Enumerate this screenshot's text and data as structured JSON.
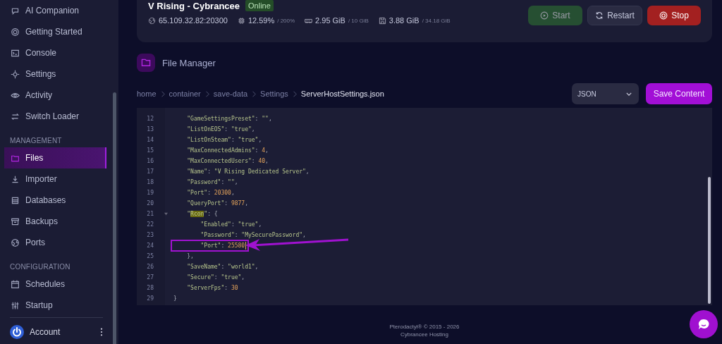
{
  "sidebar": {
    "sections": [
      {
        "items": [
          {
            "label": "AI Companion",
            "selected": false
          },
          {
            "label": "Getting Started",
            "selected": false
          },
          {
            "label": "Console",
            "selected": false
          },
          {
            "label": "Settings",
            "selected": false
          },
          {
            "label": "Activity",
            "selected": false
          },
          {
            "label": "Switch Loader",
            "selected": false
          }
        ]
      },
      {
        "title": "MANAGEMENT",
        "items": [
          {
            "label": "Files",
            "selected": true
          },
          {
            "label": "Importer",
            "selected": false
          },
          {
            "label": "Databases",
            "selected": false
          },
          {
            "label": "Backups",
            "selected": false
          },
          {
            "label": "Ports",
            "selected": false
          }
        ]
      },
      {
        "title": "CONFIGURATION",
        "items": [
          {
            "label": "Schedules",
            "selected": false
          },
          {
            "label": "Startup",
            "selected": false
          }
        ]
      }
    ],
    "account": "Account"
  },
  "server": {
    "name": "V Rising - Cybrancee",
    "status": "Online",
    "stats": [
      {
        "value": "65.109.32.82:20300"
      },
      {
        "value": "12.59%",
        "limit": "/ 200%"
      },
      {
        "value": "2.95 GiB",
        "limit": "/ 10 GiB"
      },
      {
        "value": "3.88 GiB",
        "limit": "/ 34.18 GiB"
      }
    ],
    "buttons": [
      {
        "label": "Start",
        "kind": "start",
        "disabled": true
      },
      {
        "label": "Restart",
        "kind": "restart",
        "disabled": false
      },
      {
        "label": "Stop",
        "kind": "stop",
        "disabled": false
      }
    ]
  },
  "file_manager": {
    "title": "File Manager",
    "breadcrumb": [
      "home",
      "container",
      "save-data",
      "Settings",
      "ServerHostSettings.json"
    ],
    "mode": "JSON",
    "save_button": "Save Content",
    "lines": [
      {
        "number": "12",
        "parts": [
          {
            "kind": "str",
            "text": "    \"GameSettingsPreset\""
          },
          {
            "kind": "punct",
            "text": ": "
          },
          {
            "kind": "str",
            "text": "\"\""
          },
          {
            "kind": "punct",
            "text": ","
          }
        ]
      },
      {
        "number": "13",
        "parts": [
          {
            "kind": "str",
            "text": "    \"ListOnEOS\""
          },
          {
            "kind": "punct",
            "text": ": "
          },
          {
            "kind": "str",
            "text": "\"true\""
          },
          {
            "kind": "punct",
            "text": ","
          }
        ]
      },
      {
        "number": "14",
        "parts": [
          {
            "kind": "str",
            "text": "    \"ListOnSteam\""
          },
          {
            "kind": "punct",
            "text": ": "
          },
          {
            "kind": "str",
            "text": "\"true\""
          },
          {
            "kind": "punct",
            "text": ","
          }
        ]
      },
      {
        "number": "15",
        "parts": [
          {
            "kind": "str",
            "text": "    \"MaxConnectedAdmins\""
          },
          {
            "kind": "punct",
            "text": ": "
          },
          {
            "kind": "num",
            "text": "4"
          },
          {
            "kind": "punct",
            "text": ","
          }
        ]
      },
      {
        "number": "16",
        "parts": [
          {
            "kind": "str",
            "text": "    \"MaxConnectedUsers\""
          },
          {
            "kind": "punct",
            "text": ": "
          },
          {
            "kind": "num",
            "text": "40"
          },
          {
            "kind": "punct",
            "text": ","
          }
        ]
      },
      {
        "number": "17",
        "parts": [
          {
            "kind": "str",
            "text": "    \"Name\""
          },
          {
            "kind": "punct",
            "text": ": "
          },
          {
            "kind": "str",
            "text": "\"V Rising Dedicated Server\""
          },
          {
            "kind": "punct",
            "text": ","
          }
        ]
      },
      {
        "number": "18",
        "parts": [
          {
            "kind": "str",
            "text": "    \"Password\""
          },
          {
            "kind": "punct",
            "text": ": "
          },
          {
            "kind": "str",
            "text": "\"\""
          },
          {
            "kind": "punct",
            "text": ","
          }
        ]
      },
      {
        "number": "19",
        "parts": [
          {
            "kind": "str",
            "text": "    \"Port\""
          },
          {
            "kind": "punct",
            "text": ": "
          },
          {
            "kind": "num",
            "text": "20300"
          },
          {
            "kind": "punct",
            "text": ","
          }
        ]
      },
      {
        "number": "20",
        "parts": [
          {
            "kind": "str",
            "text": "    \"QueryPort\""
          },
          {
            "kind": "punct",
            "text": ": "
          },
          {
            "kind": "num",
            "text": "9877"
          },
          {
            "kind": "punct",
            "text": ","
          }
        ]
      },
      {
        "number": "21",
        "foldable": true,
        "parts": [
          {
            "kind": "str",
            "text": "    \""
          },
          {
            "kind": "match",
            "text": "Rcon"
          },
          {
            "kind": "str",
            "text": "\""
          },
          {
            "kind": "punct",
            "text": ": {"
          }
        ]
      },
      {
        "number": "22",
        "parts": [
          {
            "kind": "str",
            "text": "        \"Enabled\""
          },
          {
            "kind": "punct",
            "text": ": "
          },
          {
            "kind": "str",
            "text": "\"true\""
          },
          {
            "kind": "punct",
            "text": ","
          }
        ]
      },
      {
        "number": "23",
        "parts": [
          {
            "kind": "str",
            "text": "        \"Password\""
          },
          {
            "kind": "punct",
            "text": ": "
          },
          {
            "kind": "str",
            "text": "\"MySecurePassword\""
          },
          {
            "kind": "punct",
            "text": ","
          }
        ]
      },
      {
        "number": "24",
        "annotated": true,
        "parts": [
          {
            "kind": "str",
            "text": "        \"Port\""
          },
          {
            "kind": "punct",
            "text": ": "
          },
          {
            "kind": "num",
            "text": "25580"
          }
        ]
      },
      {
        "number": "25",
        "parts": [
          {
            "kind": "punct",
            "text": "    },"
          }
        ]
      },
      {
        "number": "26",
        "parts": [
          {
            "kind": "str",
            "text": "    \"SaveName\""
          },
          {
            "kind": "punct",
            "text": ": "
          },
          {
            "kind": "str",
            "text": "\"world1\""
          },
          {
            "kind": "punct",
            "text": ","
          }
        ]
      },
      {
        "number": "27",
        "parts": [
          {
            "kind": "str",
            "text": "    \"Secure\""
          },
          {
            "kind": "punct",
            "text": ": "
          },
          {
            "kind": "str",
            "text": "\"true\""
          },
          {
            "kind": "punct",
            "text": ","
          }
        ]
      },
      {
        "number": "28",
        "parts": [
          {
            "kind": "str",
            "text": "    \"ServerFps\""
          },
          {
            "kind": "punct",
            "text": ": "
          },
          {
            "kind": "num",
            "text": "30"
          }
        ]
      },
      {
        "number": "29",
        "parts": [
          {
            "kind": "punct",
            "text": "}"
          }
        ]
      }
    ]
  },
  "footer": [
    "Pterodactyl® © 2015 - 2026",
    "Cybrancee Hosting"
  ]
}
